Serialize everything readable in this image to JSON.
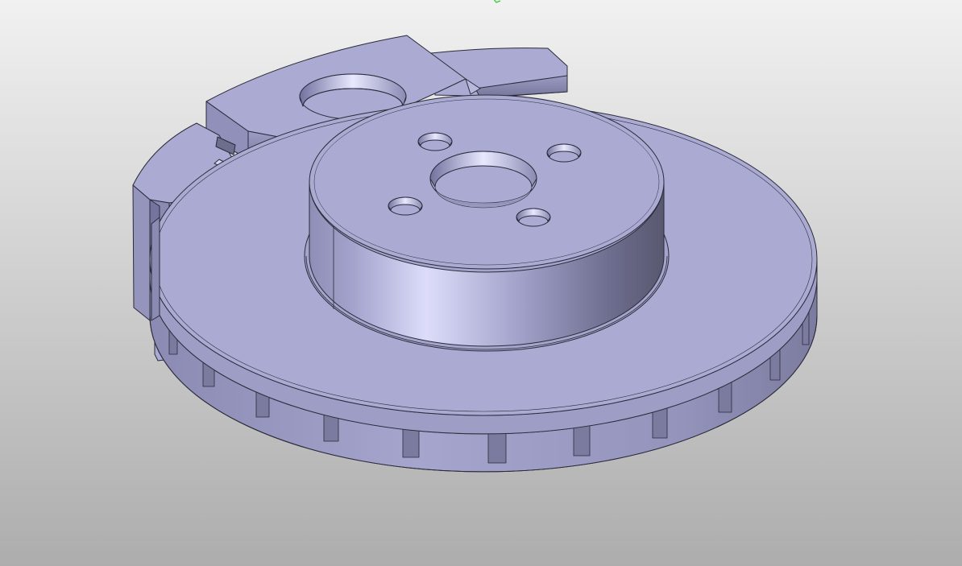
{
  "viewport": {
    "background_top": "#f1f1f1",
    "background_bottom": "#adadad",
    "model": "brake-disc-and-caliper-assembly",
    "shading": "shaded-with-edges",
    "part_color": "#aaaad2",
    "edge_color": "#2b2b3a"
  },
  "model_features": {
    "lug_holes": 4,
    "center_bore": 1,
    "vented_rotor": true,
    "caliper_bracket": true
  },
  "indicators": {
    "axis_marker_icon": "triad-corner-icon",
    "axis_marker_color": "#33cc33"
  }
}
